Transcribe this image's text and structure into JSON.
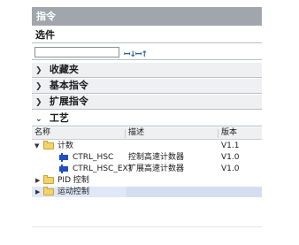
{
  "panel": {
    "title": "指令"
  },
  "options": {
    "label": "选件",
    "search_value": "",
    "search_placeholder": ""
  },
  "icons": {
    "search_down": "search-down-icon",
    "search_up": "search-up-icon"
  },
  "sections": [
    {
      "label": "收藏夹",
      "state": "collapsed"
    },
    {
      "label": "基本指令",
      "state": "collapsed"
    },
    {
      "label": "扩展指令",
      "state": "collapsed"
    },
    {
      "label": "工艺",
      "state": "expanded"
    }
  ],
  "table": {
    "columns": [
      "名称",
      "描述",
      "版本"
    ],
    "rows": [
      {
        "name": "计数",
        "desc": "",
        "version": "V1.1",
        "type": "folder",
        "expanded": true
      },
      {
        "name": "CTRL_HSC",
        "desc": "控制高速计数器",
        "version": "V1.0",
        "type": "block"
      },
      {
        "name": "CTRL_HSC_EXT",
        "desc": "扩展高速计数器",
        "version": "V1.0",
        "type": "block"
      },
      {
        "name": "PID 控制",
        "desc": "",
        "version": "",
        "type": "folder",
        "expanded": false
      },
      {
        "name": "运动控制",
        "desc": "",
        "version": "",
        "type": "folder",
        "expanded": false,
        "selected": true
      }
    ]
  },
  "colors": {
    "title_bar": "#a0a6ac",
    "selection": "#d3def1",
    "block_icon": "#1f4fc1",
    "folder": "#f3d36a"
  }
}
